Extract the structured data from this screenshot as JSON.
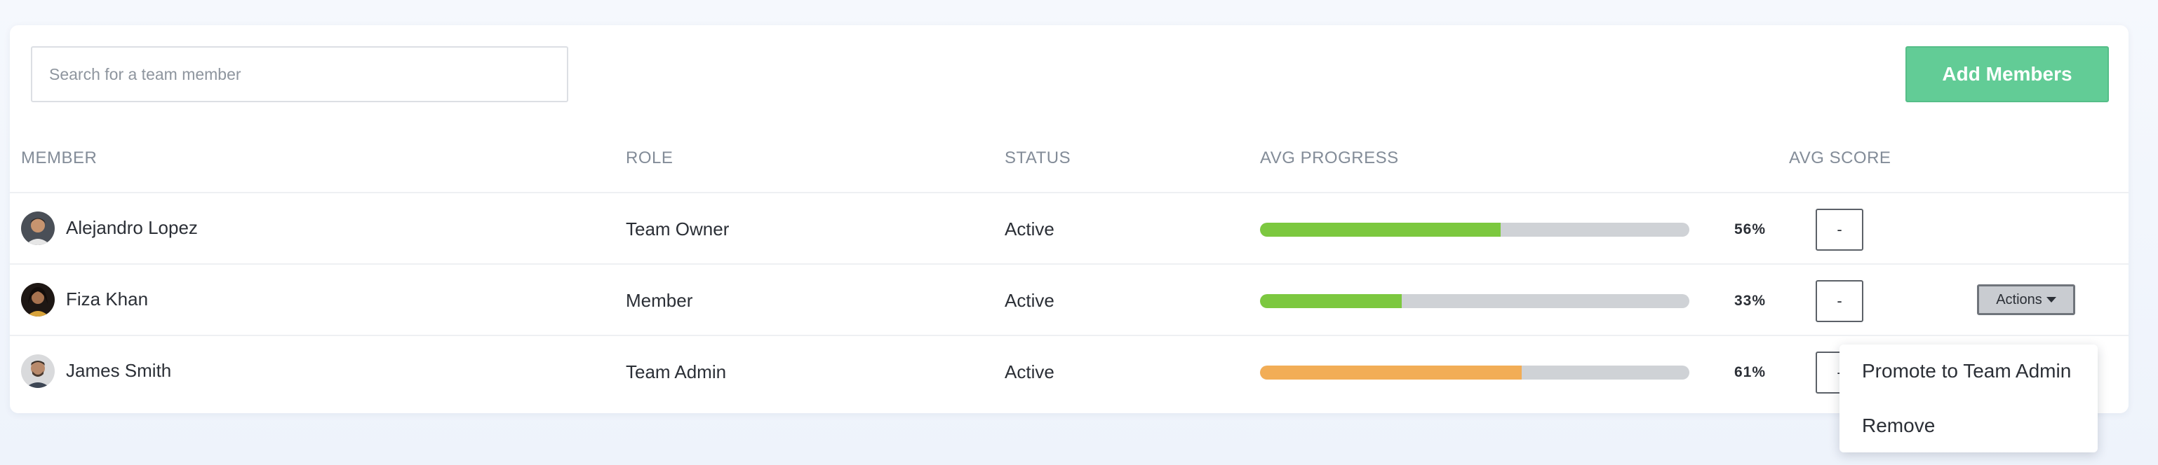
{
  "search": {
    "placeholder": "Search for a team member"
  },
  "header_actions": {
    "add_label": "Add Members"
  },
  "columns": {
    "member": "MEMBER",
    "role": "ROLE",
    "status": "STATUS",
    "progress": "AVG PROGRESS",
    "score": "AVG SCORE"
  },
  "rows": [
    {
      "name": "Alejandro Lopez",
      "role": "Team Owner",
      "status": "Active",
      "progress": 0.56,
      "progress_label": "56%",
      "progress_color": "#7cc83f",
      "score": "-"
    },
    {
      "name": "Fiza Khan",
      "role": "Member",
      "status": "Active",
      "progress": 0.33,
      "progress_label": "33%",
      "progress_color": "#7cc83f",
      "score": "-"
    },
    {
      "name": "James Smith",
      "role": "Team Admin",
      "status": "Active",
      "progress": 0.61,
      "progress_label": "61%",
      "progress_color": "#f2ad56",
      "score": "-"
    }
  ],
  "actions": {
    "button_label": "Actions",
    "menu": [
      "Promote to Team Admin",
      "Remove"
    ]
  },
  "colors": {
    "accent": "#62cc96",
    "progress_track": "#cfd2d6"
  },
  "icons": {
    "dropdown": "caret-down-icon",
    "avatar": "user-avatar"
  }
}
